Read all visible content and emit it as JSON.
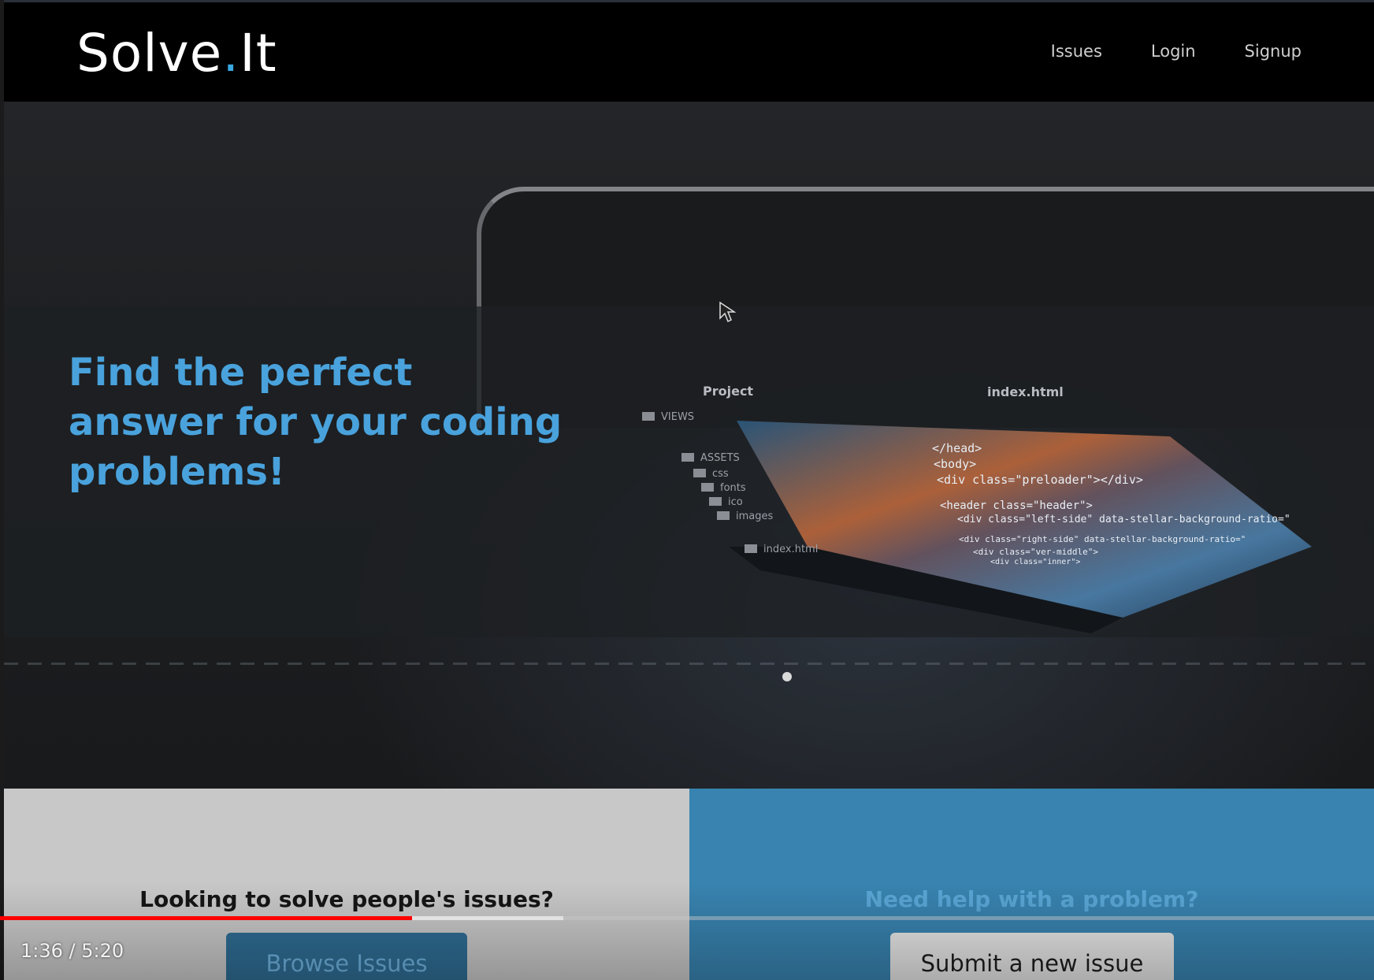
{
  "navbar": {
    "brand_part1": "Solve",
    "brand_dot": ".",
    "brand_part2": "It",
    "links": [
      "Issues",
      "Login",
      "Signup"
    ]
  },
  "hero": {
    "heading": "Find the perfect answer for your coding problems!",
    "editor": {
      "project_label": "Project",
      "file_tab": "index.html",
      "tree": [
        "VIEWS",
        "ASSETS",
        "css",
        "fonts",
        "ico",
        "images",
        "index.html"
      ],
      "code_lines": [
        "</head>",
        "<body>",
        "<div class=\"preloader\"></div>",
        "<header class=\"header\">",
        "<div class=\"left-side\" data-stellar-background-ratio=\"",
        "<div class=\"right-side\" data-stellar-background-ratio=\"",
        "<div class=\"ver-middle\">",
        "<div class=\"inner\">"
      ]
    },
    "carousel_active_index": 1
  },
  "panels": {
    "left": {
      "heading": "Looking to solve people's issues?",
      "button": "Browse Issues"
    },
    "right": {
      "heading": "Need help with a problem?",
      "button": "Submit a new issue"
    }
  },
  "player": {
    "time": "1:36 / 5:20",
    "played_fraction": 0.3,
    "buffered_fraction": 0.41,
    "colors": {
      "played": "#ff0000",
      "buffered": "#ebebeb"
    }
  },
  "colors": {
    "accent": "#3aa8e0",
    "hero_heading": "#49a2dc",
    "right_panel": "#3883b0",
    "left_panel": "#c8c8c8"
  }
}
